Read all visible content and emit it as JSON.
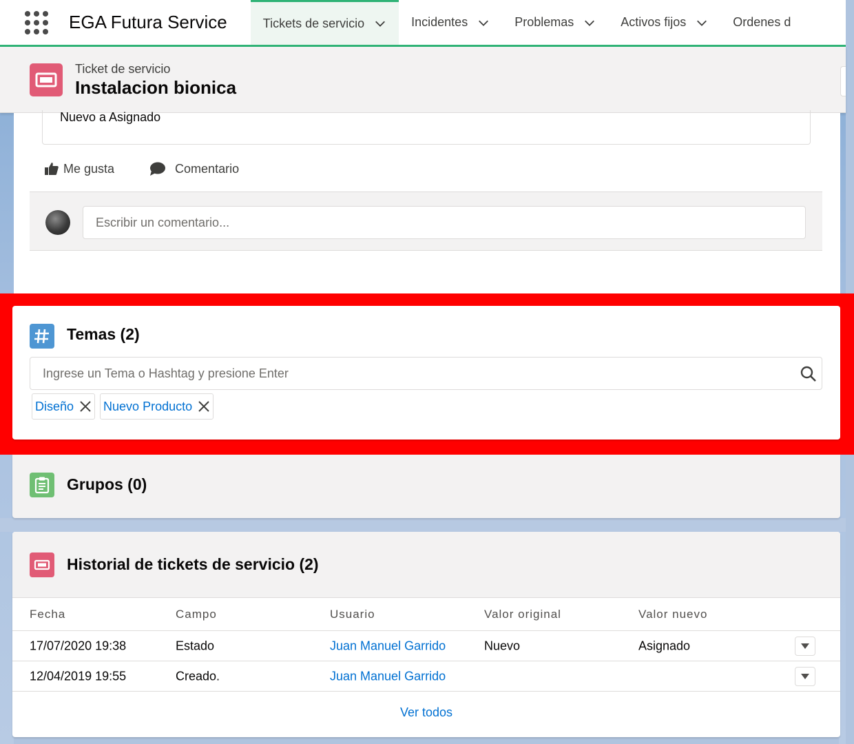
{
  "app": {
    "name": "EGA Futura Service"
  },
  "nav": {
    "tabs": [
      {
        "label": "Tickets de servicio",
        "active": true
      },
      {
        "label": "Incidentes",
        "active": false
      },
      {
        "label": "Problemas",
        "active": false
      },
      {
        "label": "Activos fijos",
        "active": false
      },
      {
        "label": "Ordenes d",
        "active": false
      }
    ]
  },
  "record": {
    "object_label": "Ticket de servicio",
    "title": "Instalacion bionica"
  },
  "feed": {
    "post_text": "Nuevo a Asignado",
    "like_label": "Me gusta",
    "comment_label": "Comentario",
    "comment_placeholder": "Escribir un comentario..."
  },
  "topics": {
    "title": "Temas (2)",
    "input_placeholder": "Ingrese un Tema o Hashtag y presione Enter",
    "items": [
      "Diseño",
      "Nuevo Producto"
    ]
  },
  "groups": {
    "title": "Grupos (0)"
  },
  "history": {
    "title": "Historial de tickets de servicio (2)",
    "columns": [
      "Fecha",
      "Campo",
      "Usuario",
      "Valor original",
      "Valor nuevo"
    ],
    "rows": [
      {
        "fecha": "17/07/2020 19:38",
        "campo": "Estado",
        "usuario": "Juan Manuel Garrido",
        "original": "Nuevo",
        "nuevo": "Asignado"
      },
      {
        "fecha": "12/04/2019 19:55",
        "campo": "Creado.",
        "usuario": "Juan Manuel Garrido",
        "original": "",
        "nuevo": ""
      }
    ],
    "view_all": "Ver todos"
  },
  "colors": {
    "brand_green": "#2fb376",
    "ticket_icon": "#e15b76",
    "topics_icon": "#4e96d3",
    "groups_icon": "#6fbf73",
    "link": "#0070d2",
    "highlight": "#ff0000"
  },
  "icons": {
    "app_launcher": "waffle-icon",
    "ticket": "ticket-icon",
    "topics": "hashtag-icon",
    "groups": "clipboard-icon",
    "search": "search-icon",
    "like": "thumbs-up-icon",
    "comment": "speech-bubble-icon"
  }
}
